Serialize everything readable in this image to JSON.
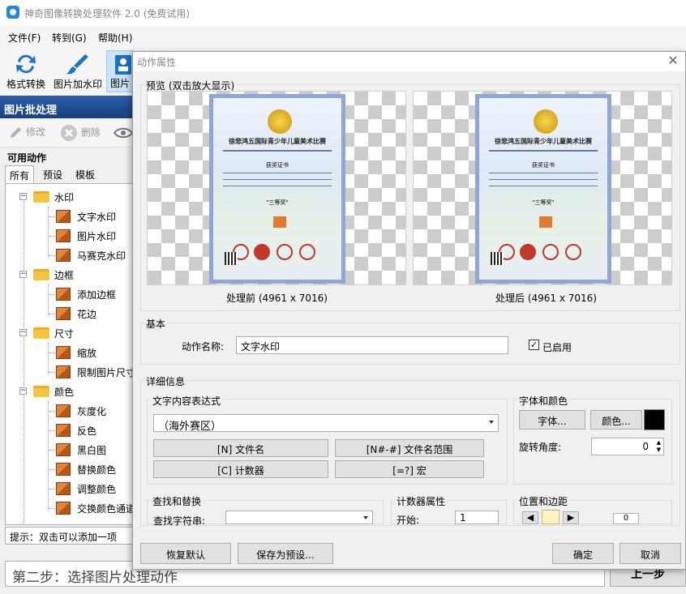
{
  "app": {
    "title": "神奇图像转换处理软件 2.0 (免费试用)"
  },
  "menu": [
    "文件(F)",
    "转到(G)",
    "帮助(H)"
  ],
  "toolbar": {
    "format_convert": "格式转换",
    "watermark": "图片加水印",
    "batch_partial": "图片"
  },
  "left_panel": {
    "header": "图片批处理",
    "edit_label": "修改",
    "delete_label": "删除",
    "available_actions": "可用动作",
    "tabs": [
      "所有",
      "预设",
      "模板"
    ],
    "tree": [
      {
        "label": "水印",
        "children": [
          "文字水印",
          "图片水印",
          "马赛克水印"
        ]
      },
      {
        "label": "边框",
        "children": [
          "添加边框",
          "花边"
        ]
      },
      {
        "label": "尺寸",
        "children": [
          "缩放",
          "限制图片尺寸"
        ]
      },
      {
        "label": "颜色",
        "children": [
          "灰度化",
          "反色",
          "黑白图",
          "替换颜色",
          "调整颜色",
          "交换颜色通道"
        ]
      }
    ],
    "hint": "提示：双击可以添加一项"
  },
  "bottom": {
    "step": "第二步：选择图片处理动作",
    "prev_button": "上一步"
  },
  "dialog": {
    "title": "动作属性",
    "preview_label": "预览 (双击放大显示)",
    "before_caption": "处理前 (4961 x 7016)",
    "after_caption": "处理后 (4961 x 7016)",
    "basic_label": "基本",
    "action_name_label": "动作名称:",
    "action_name_value": "文字水印",
    "enabled_label": "已启用",
    "enabled": true,
    "details_label": "详细信息",
    "text_expr_label": "文字内容表达式",
    "text_expr_value": "（海外赛区）",
    "btn_filename": "[N] 文件名",
    "btn_filename_range": "[N#-#] 文件名范围",
    "btn_counter": "[C] 计数器",
    "btn_macro": "[=?] 宏",
    "font_color_label": "字体和颜色",
    "font_button": "字体...",
    "color_button": "颜色...",
    "color_swatch": "#000000",
    "rotate_label": "旋转角度:",
    "rotate_value": "0",
    "find_replace_label": "查找和替换",
    "find_label": "查找字符串:",
    "counter_label": "计数器属性",
    "start_label": "开始:",
    "start_value": "1",
    "position_label": "位置和边距",
    "margin_value": "0",
    "reset_button": "恢复默认",
    "save_preset_button": "保存为预设...",
    "ok_button": "确定",
    "cancel_button": "取消"
  },
  "certificate": {
    "heading": "徐悲鸿五国际青少年儿童美术比赛",
    "sub": "获奖证书",
    "award": "\"三等奖\""
  }
}
